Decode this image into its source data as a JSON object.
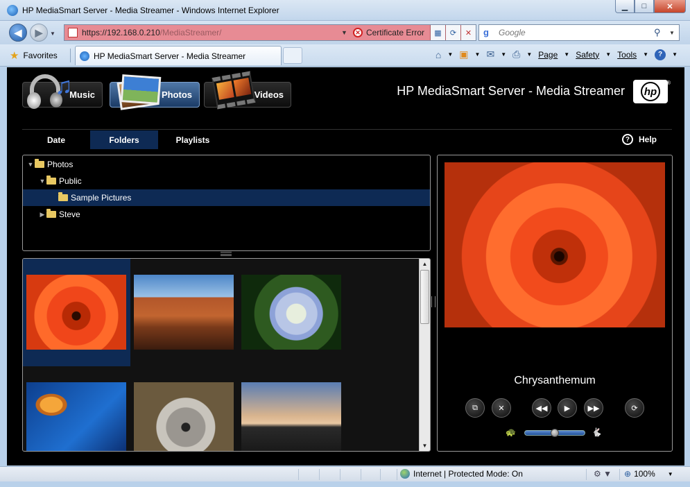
{
  "window": {
    "title": "HP MediaSmart Server - Media Streamer - Windows Internet Explorer",
    "minimize": "▁",
    "maximize": "□",
    "close": "✕"
  },
  "navigation": {
    "back": "◀",
    "forward": "▶",
    "address_host": "https://192.168.0.210",
    "address_path": "/MediaStreamer/",
    "certificate_label": "Certificate Error",
    "search_engine": "Google",
    "search_placeholder": "Google"
  },
  "tabs_bar": {
    "favorites_label": "Favorites",
    "tab_title": "HP MediaSmart Server - Media Streamer",
    "commands": [
      "Page",
      "Safety",
      "Tools"
    ]
  },
  "app": {
    "brand_title": "HP MediaSmart Server - Media Streamer",
    "logo_text": "hp",
    "logo_reg": "®",
    "media_buttons": [
      {
        "label": "Music",
        "active": false
      },
      {
        "label": "Photos",
        "active": true
      },
      {
        "label": "Videos",
        "active": false
      }
    ],
    "subtabs": [
      {
        "label": "Date",
        "active": false
      },
      {
        "label": "Folders",
        "active": true
      },
      {
        "label": "Playlists",
        "active": false
      }
    ],
    "help_label": "Help",
    "tree": [
      {
        "label": "Photos",
        "expanded": true,
        "selected": false
      },
      {
        "label": "Public",
        "expanded": true,
        "selected": false
      },
      {
        "label": "Sample Pictures",
        "expanded": null,
        "selected": true
      },
      {
        "label": "Steve",
        "expanded": false,
        "selected": false
      }
    ],
    "thumbnails": [
      {
        "subject": "chrysanthemum",
        "selected": true
      },
      {
        "subject": "desert",
        "selected": false
      },
      {
        "subject": "hydrangeas",
        "selected": false
      },
      {
        "subject": "jellyfish",
        "selected": false
      },
      {
        "subject": "koala",
        "selected": false
      },
      {
        "subject": "lighthouse",
        "selected": false
      }
    ],
    "viewer": {
      "caption": "Chrysanthemum",
      "speed": 0.5
    }
  },
  "status": {
    "zone": "Internet | Protected Mode: On",
    "zoom": "100%"
  }
}
